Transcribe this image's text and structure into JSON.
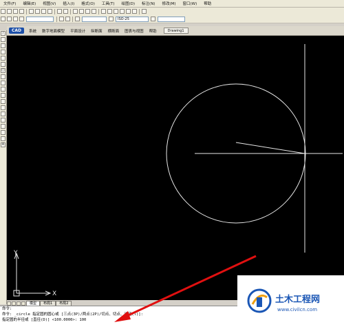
{
  "menu": [
    "文件(F)",
    "编辑(E)",
    "视图(V)",
    "插入(I)",
    "格式(O)",
    "工具(T)",
    "绘图(D)",
    "标注(N)",
    "修改(M)",
    "窗口(W)",
    "帮助"
  ],
  "toolbar": {
    "dimstyle": "ISO-25"
  },
  "ribbon": {
    "logo": "CAD",
    "tabs": [
      "系统",
      "数字地面模型",
      "平面设计",
      "纵断面",
      "横断面",
      "图表与视图",
      "帮助"
    ],
    "document_tab": "Drawing1"
  },
  "layout_tabs": {
    "model": "模型",
    "layout1": "布局1",
    "layout2": "布局2"
  },
  "command": {
    "line1": "命令:",
    "line2": "命令: _circle 指定圆的圆心或 [三点(3P)/两点(2P)/切点、切点、半径(T)]:",
    "line3": "指定圆的半径或 [直径(D)] <100.0000>: 100"
  },
  "ucs": {
    "x_label": "X",
    "y_label": "Y"
  },
  "watermark": {
    "title": "土木工程网",
    "url": "www.civilcn.com"
  }
}
